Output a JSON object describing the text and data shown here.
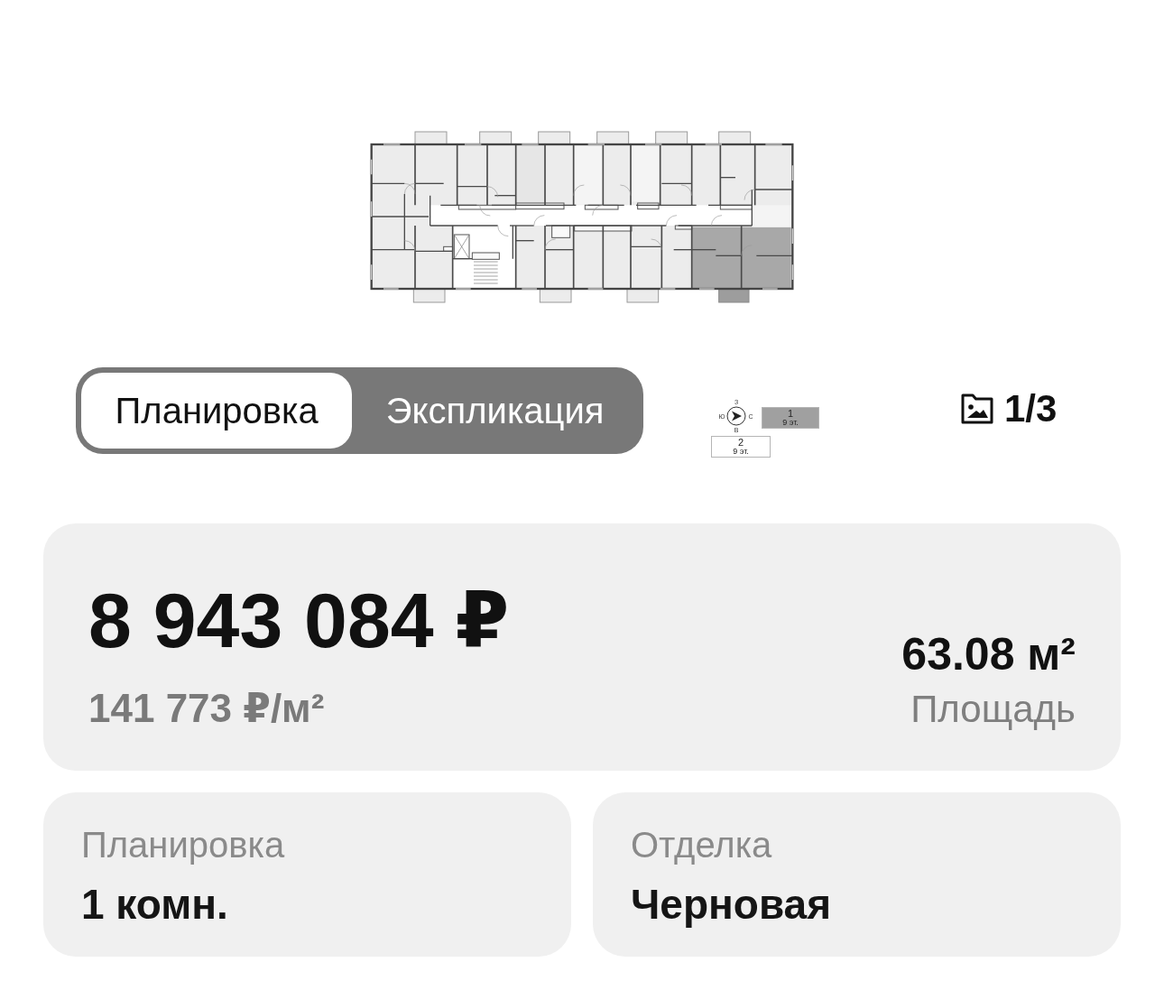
{
  "view_tabs": [
    {
      "label": "Планировка",
      "selected": true
    },
    {
      "label": "Экспликация",
      "selected": false
    }
  ],
  "orientation_key": {
    "compass": {
      "west": "З",
      "south": "Ю",
      "north": "С",
      "east": "В"
    },
    "sections": [
      {
        "number": "1",
        "floors": "9 эт.",
        "selected": true
      },
      {
        "number": "2",
        "floors": "9 эт.",
        "selected": false
      }
    ]
  },
  "gallery_counter": "1/3",
  "price_card": {
    "price": "8 943 084 ₽",
    "price_per_m2": "141 773 ₽/м²",
    "area": "63.08 м²",
    "area_label": "Площадь"
  },
  "details": [
    {
      "label": "Планировка",
      "value": "1 комн."
    },
    {
      "label": "Отделка",
      "value": "Черновая"
    }
  ]
}
